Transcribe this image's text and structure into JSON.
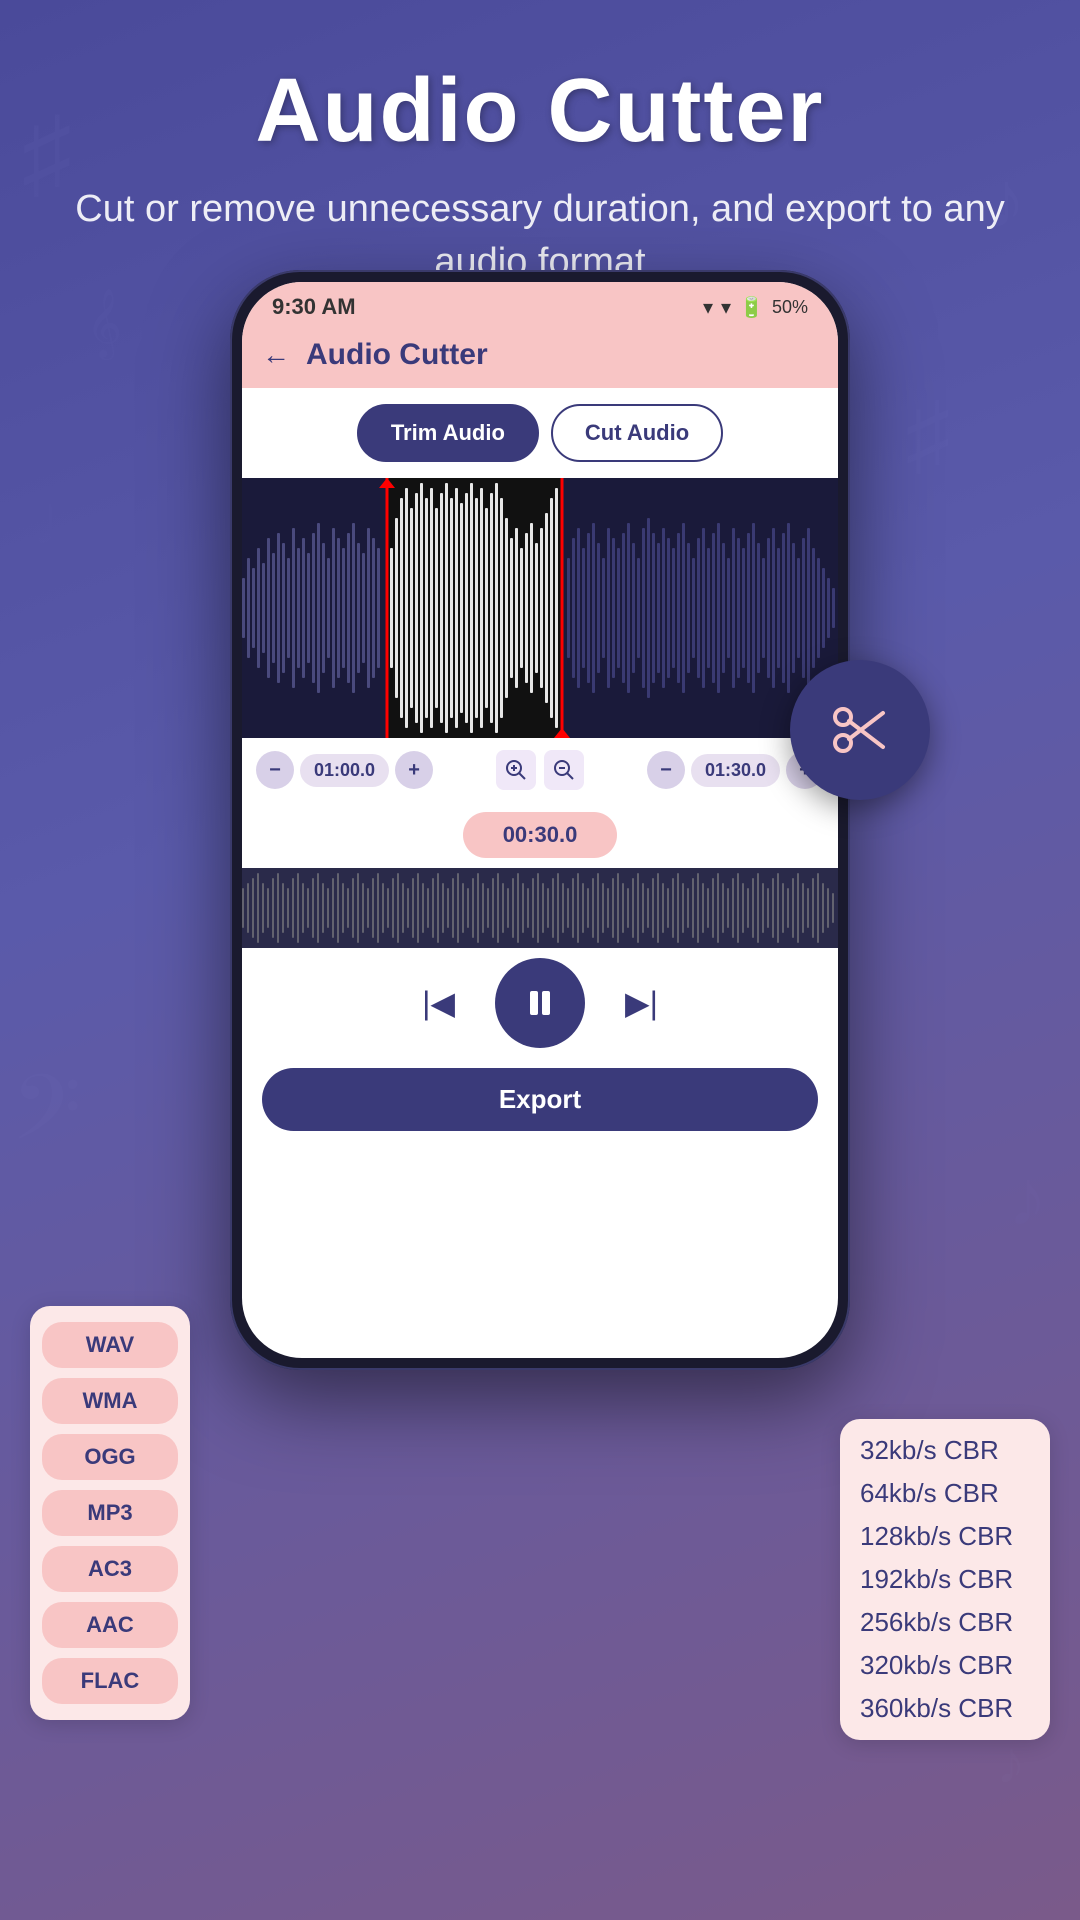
{
  "header": {
    "title": "Audio Cutter",
    "subtitle": "Cut or remove unnecessary duration, and export to any audio format"
  },
  "statusBar": {
    "time": "9:30 AM",
    "battery": "50%",
    "wifi": "▾",
    "signal": "▾"
  },
  "appBar": {
    "title": "Audio Cutter",
    "backLabel": "←"
  },
  "tabs": [
    {
      "label": "Trim Audio",
      "active": true
    },
    {
      "label": "Cut Audio",
      "active": false
    }
  ],
  "controls": {
    "startTime": "01:00.0",
    "endTime": "01:30.0",
    "duration": "00:30.0"
  },
  "formats": [
    "WAV",
    "WMA",
    "OGG",
    "MP3",
    "AC3",
    "AAC",
    "FLAC"
  ],
  "bitrates": [
    "32kb/s CBR",
    "64kb/s CBR",
    "128kb/s CBR",
    "192kb/s CBR",
    "256kb/s CBR",
    "320kb/s CBR",
    "360kb/s CBR"
  ],
  "buttons": {
    "export": "Export",
    "zoomIn": "🔍+",
    "zoomOut": "🔍-",
    "minus": "−",
    "plus": "+"
  },
  "colors": {
    "primary": "#3a3a7a",
    "accent": "#f8c5c5",
    "background": "#4a4a9a"
  }
}
